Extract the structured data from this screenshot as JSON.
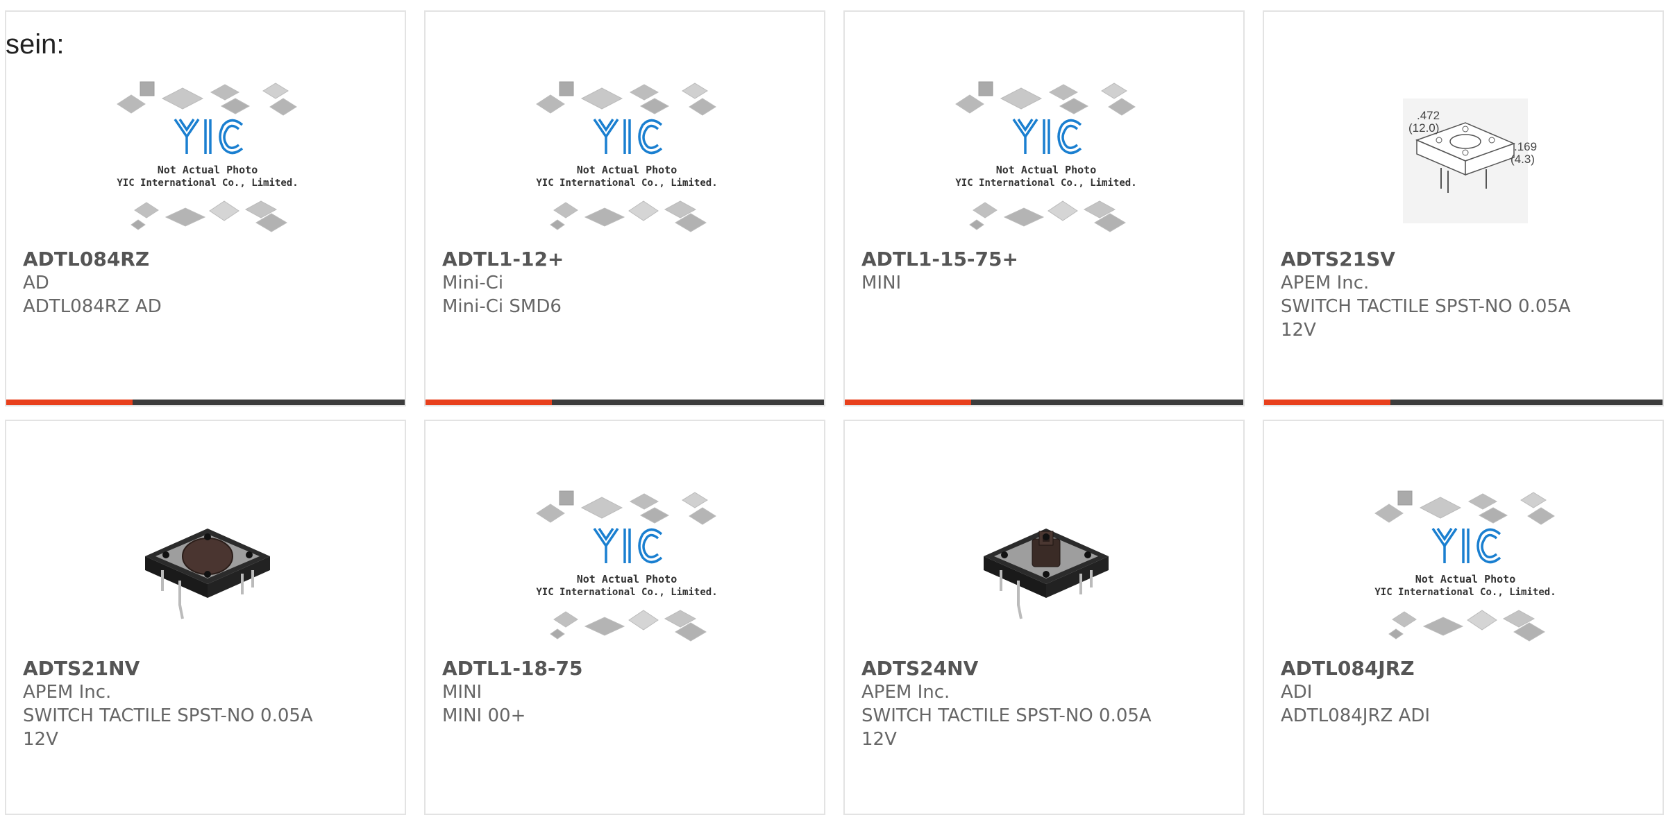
{
  "intro_text": "sein:",
  "colors": {
    "accent": "#e8401c",
    "bar": "#3c3c3c",
    "logo": "#1a7fd0"
  },
  "placeholder_image": {
    "title": "Not Actual Photo",
    "company": "YIC International Co., Limited.",
    "logo_text": "YIC"
  },
  "dimension_drawing": {
    "width_in": ".472",
    "width_mm": "(12.0)",
    "height_in": ".169",
    "height_mm": "(4.3)"
  },
  "products": [
    {
      "part_number": "ADTL084RZ",
      "manufacturer": "AD",
      "description": "ADTL084RZ AD",
      "image": "placeholder",
      "accent": true
    },
    {
      "part_number": "ADTL1-12+",
      "manufacturer": "Mini-Ci",
      "description": "Mini-Ci SMD6",
      "image": "placeholder",
      "accent": true
    },
    {
      "part_number": "ADTL1-15-75+",
      "manufacturer": "MINI",
      "description": "",
      "image": "placeholder",
      "accent": true
    },
    {
      "part_number": "ADTS21SV",
      "manufacturer": "APEM Inc.",
      "description": "SWITCH TACTILE SPST-NO 0.05A 12V",
      "image": "dimension-drawing",
      "accent": true
    },
    {
      "part_number": "ADTS21NV",
      "manufacturer": "APEM Inc.",
      "description": "SWITCH TACTILE SPST-NO 0.05A 12V",
      "image": "tactile-switch-round"
    },
    {
      "part_number": "ADTL1-18-75",
      "manufacturer": "MINI",
      "description": "MINI 00+",
      "image": "placeholder"
    },
    {
      "part_number": "ADTS24NV",
      "manufacturer": "APEM Inc.",
      "description": "SWITCH TACTILE SPST-NO 0.05A 12V",
      "image": "tactile-switch-square"
    },
    {
      "part_number": "ADTL084JRZ",
      "manufacturer": "ADI",
      "description": "ADTL084JRZ ADI",
      "image": "placeholder"
    }
  ]
}
